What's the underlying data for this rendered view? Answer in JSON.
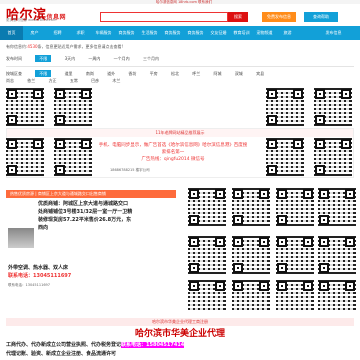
{
  "topbar": {
    "text": "哈尔滨信息网  18hrb.com  联系我们"
  },
  "logo": {
    "main": "哈尔滨",
    "sub": "信息网",
    "slogan": "更实惠可信源  www.18hrb.com"
  },
  "search": {
    "placeholder": "",
    "button": "搜索"
  },
  "right_buttons": [
    "免费发布信息",
    "查询帮助"
  ],
  "nav": [
    "首页",
    "房产",
    "招聘",
    "求职",
    "车辆服务",
    "商务服务",
    "生活服务",
    "商务服务",
    "商务服务",
    "交友征婚",
    "教育培训",
    "宠物频道",
    "旅游",
    "",
    "发布信息"
  ],
  "crumb": {
    "prefix": "有你信息约:",
    "count": "4530",
    "suffix": "条，信息更贴近用户需求，更多信息请点击查看!"
  },
  "filter1": [
    "发布时间",
    "不限",
    "3天内",
    "一周内",
    "一个月内",
    "三个月内"
  ],
  "filter2": [
    "按城区查",
    "不限",
    "道里",
    "南岗",
    "道外",
    "香坊",
    "平房",
    "松北",
    "呼兰",
    "阿城",
    "双城",
    "宾县",
    "尚志",
    "依兰",
    "方正",
    "五常",
    "巴彦",
    "木兰"
  ],
  "banner1": {
    "head": "11年老牌网站精品推荐展示",
    "text": "手机、电脑同步显示，做广告首选《哈尔滨信息网》哈尔滨信息港》百度搜索排名第一\n广告热线：qingfu2014 微信号",
    "phone": "18686788215  楼宇公司"
  },
  "orange_head": "热售优质房源 | 商铺区上京大道与通城路交口出售商铺",
  "property": {
    "line1": "优质商铺：阿城区上京大道与通城路交口",
    "line2": "处商铺铺位3号楼31/32层一室一厅一卫精",
    "line3": "装修现货房57.22平米售价26.8万元，东",
    "line4": "西向",
    "line5": "外带空调、热水器、双人床",
    "line6": "联系电话：13045111697",
    "line7": "联系电话：13045111697"
  },
  "big_head": "哈尔滨市华美企业代理工商注册",
  "big_title": "哈尔滨市华美企业代理",
  "bottom": {
    "line1a": "工商代办、代办新成立公司营业执照、代办税务登记",
    "phone": "联系电话：15804517414",
    "line2": "代理记账、验资、新成立企业注册、食品流通许可"
  },
  "colors": {
    "nav": "#12a0d8",
    "accent": "#e33",
    "orange": "#fe6b3c"
  }
}
